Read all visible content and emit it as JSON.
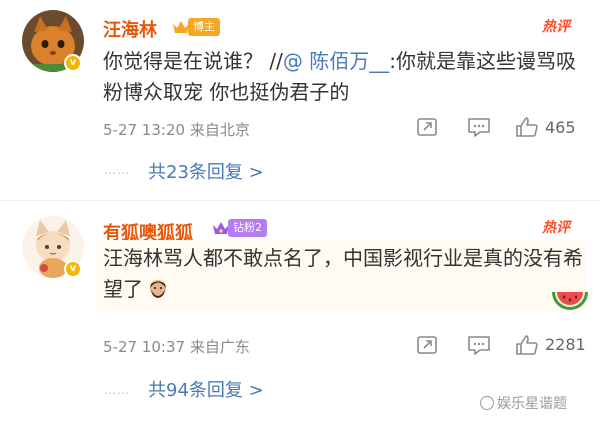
{
  "comments": [
    {
      "username": "汪海林",
      "rank_tag": "博主",
      "hot_label": "热评",
      "text_before": "你觉得是在说谁？ //",
      "mention": "@ 陈佰万__",
      "text_after": ":你就是靠这些谩骂吸粉博众取宠 你也挺伪君子的",
      "date": "5-27 13:20",
      "location": "来自北京",
      "likes": "465",
      "dots": "……",
      "replies": "共23条回复 >"
    },
    {
      "username": "有狐噢狐狐",
      "rank_tag": "钻粉2",
      "hot_label": "热评",
      "text": "汪海林骂人都不敢点名了，中国影视行业是真的没有希望了",
      "date": "5-27 10:37",
      "location": "来自广东",
      "likes": "2281",
      "dots": "……",
      "replies": "共94条回复 >"
    }
  ],
  "watermark": "娱乐星谐题",
  "colors": {
    "username": "#e8570a",
    "hot": "#ff4d2e",
    "link": "#4a79b8",
    "meta": "#8a8a8a",
    "verified": "#f7b500"
  },
  "icons": {
    "repost": "repost-icon",
    "comment": "comment-icon",
    "like": "thumbs-up-icon",
    "verified": "verified-badge-icon",
    "crown": "crown-icon"
  }
}
